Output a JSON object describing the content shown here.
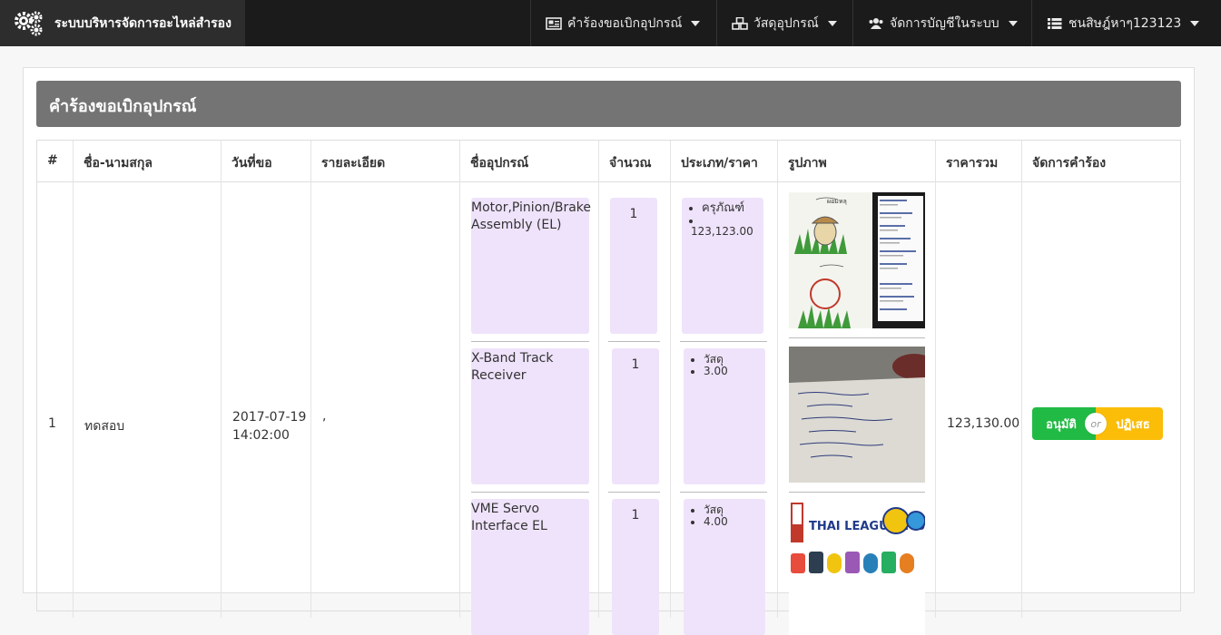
{
  "brand": {
    "title": "ระบบบริหารจัดการอะไหล่สำรอง",
    "icon": "gears-icon"
  },
  "nav": [
    {
      "label": "คำร้องขอเบิกอุปกรณ์",
      "icon": "newspaper-icon"
    },
    {
      "label": "วัสดุอุปกรณ์",
      "icon": "cubes-icon"
    },
    {
      "label": "จัดการบัญชีในระบบ",
      "icon": "users-icon"
    },
    {
      "label": "ชนสิษฎ์หาๆ123123",
      "icon": "list-icon"
    }
  ],
  "panel": {
    "title": "คำร้องขอเบิกอุปกรณ์"
  },
  "table": {
    "headers": [
      "#",
      "ชื่อ-นามสกุล",
      "วันที่ขอ",
      "รายละเอียด",
      "ชื่ออุปกรณ์",
      "จำนวณ",
      "ประเภท/ราคา",
      "รูปภาพ",
      "ราคารวม",
      "จัดการคำร้อง"
    ],
    "row": {
      "index": "1",
      "name": "ทดสอบ",
      "date": "2017-07-19",
      "time": "14:02:00",
      "detail": ",",
      "total": "123,130.00",
      "items": [
        {
          "name": "Motor,Pinion/Brake Assembly (EL)",
          "qty": "1",
          "type": "ครุภัณฑ์",
          "price": "123,123.00"
        },
        {
          "name": "X-Band Track Receiver",
          "qty": "1",
          "type": "วัสดุ",
          "price": "3.00"
        },
        {
          "name": "VME Servo Interface EL",
          "qty": "1",
          "type": "วัสดุ",
          "price": "4.00"
        }
      ],
      "approve_label": "อนุมัติ",
      "or_label": "or",
      "reject_label": "ปฏิเสธ"
    }
  },
  "colors": {
    "topbar": "#1b1b1b",
    "panel_title": "#747474",
    "item_box": "#efe3fb",
    "approve": "#21ba45",
    "reject": "#fbbd08"
  }
}
